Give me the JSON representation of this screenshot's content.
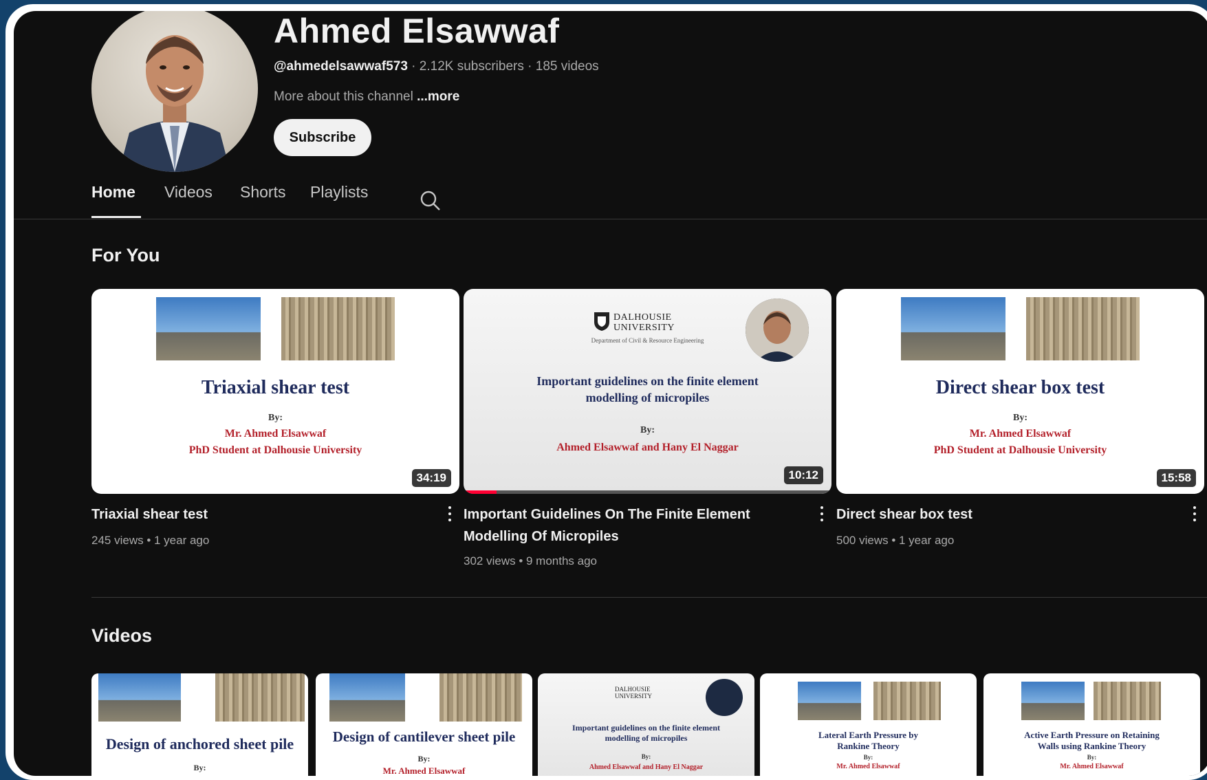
{
  "channel": {
    "name": "Ahmed Elsawwaf",
    "handle": "@ahmedelsawwaf573",
    "stats": " · 2.12K subscribers · 185 videos",
    "about": "More about this channel ",
    "more": "...more",
    "subscribe_label": "Subscribe"
  },
  "tabs": [
    {
      "label": "Home",
      "active": true
    },
    {
      "label": "Videos",
      "active": false
    },
    {
      "label": "Shorts",
      "active": false
    },
    {
      "label": "Playlists",
      "active": false
    }
  ],
  "sections": {
    "for_you": "For You",
    "videos": "Videos"
  },
  "for_you": [
    {
      "title": "Triaxial shear test",
      "meta": "245 views • 1 year ago",
      "duration": "34:19",
      "thumb": {
        "title": "Triaxial shear test",
        "by": "By:",
        "line1": "Mr. Ahmed Elsawwaf",
        "line2": "PhD Student at Dalhousie University"
      }
    },
    {
      "title": "Important Guidelines On The Finite Element Modelling Of Micropiles",
      "meta": "302 views • 9 months ago",
      "duration": "10:12",
      "watched_fraction": 0.09,
      "thumb": {
        "logo": "DALHOUSIE UNIVERSITY",
        "dept": "Department of Civil & Resource Engineering",
        "title_l1": "Important guidelines on the finite element",
        "title_l2": "modelling of micropiles",
        "by": "By:",
        "line1": "Ahmed Elsawwaf and Hany El Naggar"
      }
    },
    {
      "title": "Direct shear box test",
      "meta": "500 views • 1 year ago",
      "duration": "15:58",
      "thumb": {
        "title": "Direct shear box test",
        "by": "By:",
        "line1": "Mr. Ahmed Elsawwaf",
        "line2": "PhD Student at Dalhousie University"
      }
    }
  ],
  "videos_row": [
    {
      "thumb_title": "Design of anchored sheet pile",
      "by": "By:"
    },
    {
      "thumb_title": "Design of cantilever sheet pile",
      "by": "By:",
      "line1": "Mr. Ahmed Elsawwaf"
    },
    {
      "logo": "DALHOUSIE UNIVERSITY",
      "title_l1": "Important guidelines on the finite element",
      "title_l2": "modelling of micropiles",
      "by": "By:",
      "line1": "Ahmed Elsawwaf and Hany El Naggar"
    },
    {
      "title_l1": "Lateral Earth Pressure by",
      "title_l2": "Rankine Theory",
      "by": "By:",
      "line1": "Mr. Ahmed Elsawwaf"
    },
    {
      "title_l1": "Active Earth Pressure on Retaining",
      "title_l2": "Walls using Rankine Theory",
      "by": "By:",
      "line1": "Mr. Ahmed Elsawwaf"
    }
  ],
  "colors": {
    "background": "#0f0f0f",
    "accent": "#ff0033",
    "text": "#f1f1f1",
    "muted": "#aaaaaa"
  }
}
